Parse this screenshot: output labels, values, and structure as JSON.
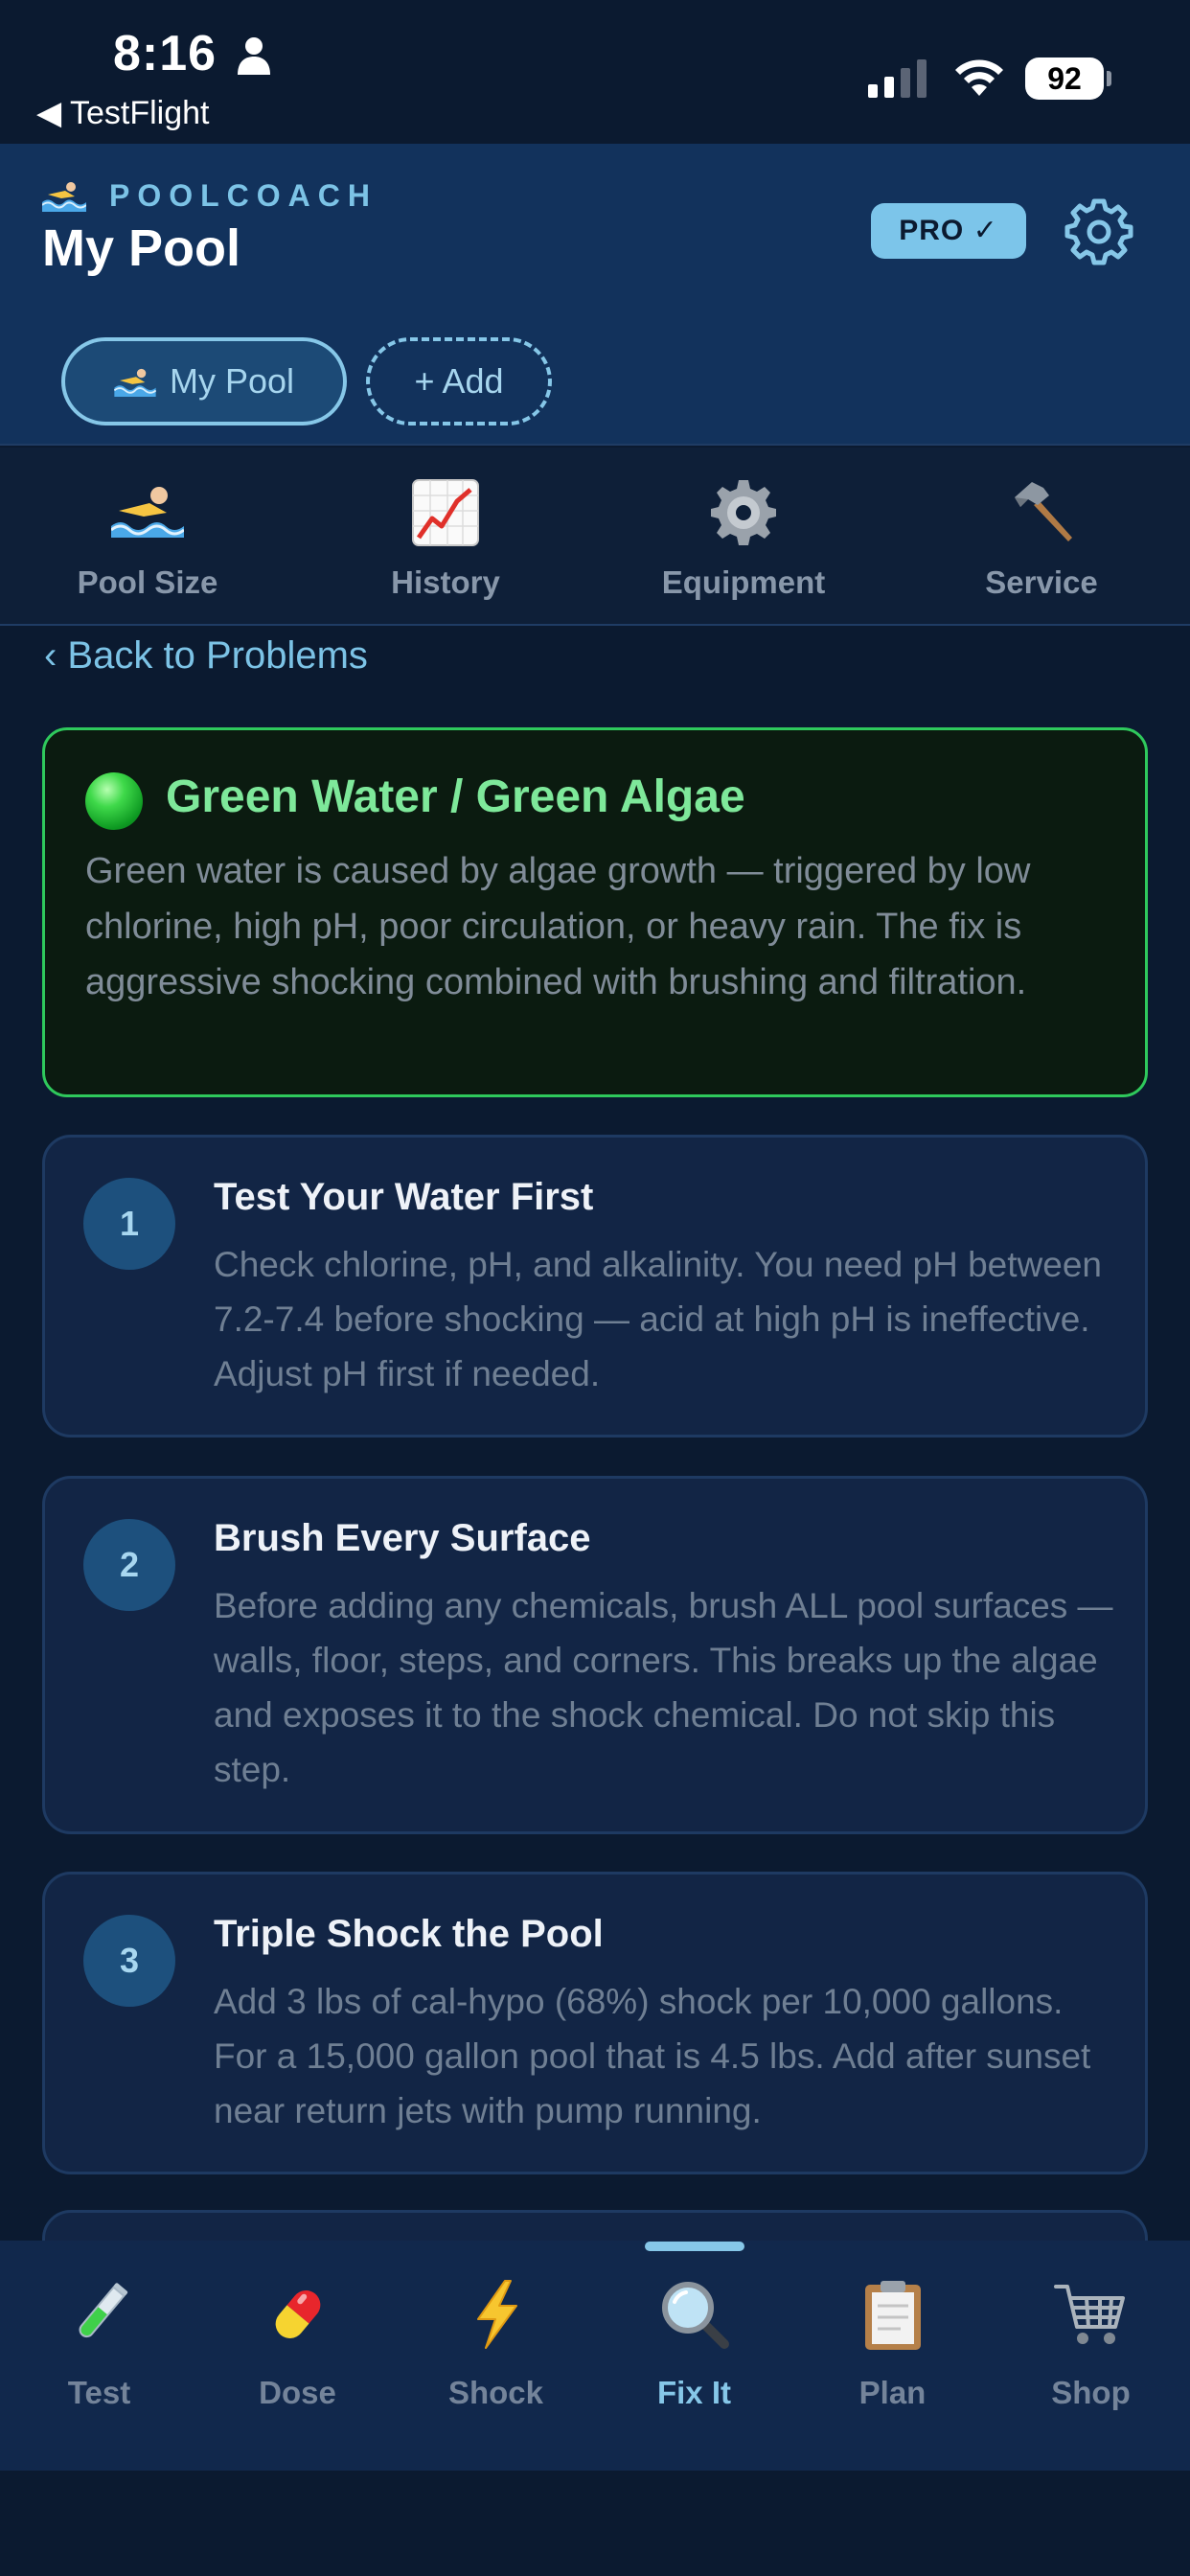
{
  "status_bar": {
    "time": "8:16",
    "back_app": "◀ TestFlight",
    "battery": "92"
  },
  "header": {
    "brand": "POOLCOACH",
    "title": "My Pool",
    "pro_badge": "PRO ✓",
    "pools": [
      {
        "label": "My Pool"
      }
    ],
    "add_label": "+ Add"
  },
  "quick_nav": [
    {
      "label": "Pool Size",
      "icon": "swimmer-icon"
    },
    {
      "label": "History",
      "icon": "chart-increasing-icon"
    },
    {
      "label": "Equipment",
      "icon": "gear-icon"
    },
    {
      "label": "Service",
      "icon": "hammer-icon"
    }
  ],
  "content": {
    "back_link": "‹ Back to Problems",
    "problem": {
      "title": "Green Water / Green Algae",
      "description": "Green water is caused by algae growth — triggered by low chlorine, high pH, poor circulation, or heavy rain. The fix is aggressive shocking combined with brushing and filtration.",
      "indicator_color": "#2fc95c"
    },
    "steps": [
      {
        "number": "1",
        "title": "Test Your Water First",
        "body": "Check chlorine, pH, and alkalinity. You need pH between 7.2-7.4 before shocking — acid at high pH is ineffective. Adjust pH first if needed."
      },
      {
        "number": "2",
        "title": "Brush Every Surface",
        "body": "Before adding any chemicals, brush ALL pool surfaces — walls, floor, steps, and corners. This breaks up the algae and exposes it to the shock chemical. Do not skip this step."
      },
      {
        "number": "3",
        "title": "Triple Shock the Pool",
        "body": "Add 3 lbs of cal-hypo (68%) shock per 10,000 gallons. For a 15,000 gallon pool that is 4.5 lbs. Add after sunset near return jets with pump running."
      }
    ]
  },
  "tabs": [
    {
      "label": "Test",
      "icon": "test-tube-icon",
      "active": false
    },
    {
      "label": "Dose",
      "icon": "pill-icon",
      "active": false
    },
    {
      "label": "Shock",
      "icon": "lightning-icon",
      "active": false
    },
    {
      "label": "Fix It",
      "icon": "magnifier-icon",
      "active": true
    },
    {
      "label": "Plan",
      "icon": "clipboard-icon",
      "active": false
    },
    {
      "label": "Shop",
      "icon": "cart-icon",
      "active": false
    }
  ],
  "colors": {
    "background": "#0b1a30",
    "header": "#12325c",
    "accent": "#86c7e8",
    "success": "#2fc95c"
  }
}
